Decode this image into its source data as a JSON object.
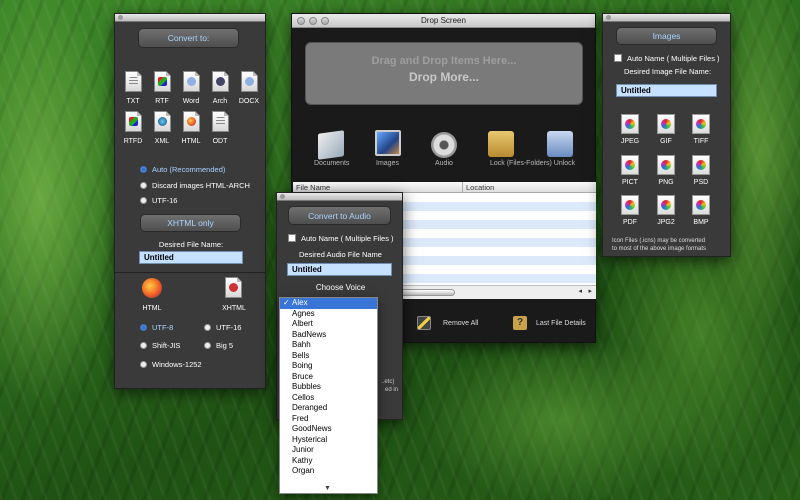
{
  "convert_panel": {
    "title_button": "Convert to:",
    "formats_row1": [
      "TXT",
      "RTF",
      "Word",
      "Arch",
      "DOCX"
    ],
    "formats_row2": [
      "RTFD",
      "XML",
      "HTML",
      "ODT"
    ],
    "options": [
      "Auto (Recommended)",
      "Discard images HTML-ARCH",
      "UTF-16"
    ],
    "xhtml_button": "XHTML only",
    "file_name_label": "Desired File Name:",
    "file_name_value": "Untitled",
    "bottom_formats": [
      "HTML",
      "XHTML"
    ],
    "encodings": [
      "UTF-8",
      "UTF-16",
      "Shift-JIS",
      "Big 5",
      "Windows-1252"
    ]
  },
  "drop_window": {
    "title": "Drop Screen",
    "drop_line1": "Drag and Drop Items Here...",
    "drop_line2": "Drop More...",
    "categories": [
      "Documents",
      "Images",
      "Audio",
      "Lock (Files-Folders) Unlock"
    ],
    "columns": [
      "File Name",
      "Location"
    ],
    "toolbar": {
      "remove_all": "Remove All",
      "last_file_details": "Last File Details"
    }
  },
  "audio_panel": {
    "title_button": "Convert to Audio",
    "auto_name": "Auto Name ( Multiple Files )",
    "file_name_label": "Desired Audio File Name",
    "file_name_value": "Untitled",
    "choose_voice": "Choose Voice",
    "selected_voice": "Alex",
    "partial_text1": "..etc)",
    "partial_text2": "ed in"
  },
  "voices": [
    "Alex",
    "Agnes",
    "Albert",
    "BadNews",
    "Bahh",
    "Bells",
    "Boing",
    "Bruce",
    "Bubbles",
    "Cellos",
    "Deranged",
    "Fred",
    "GoodNews",
    "Hysterical",
    "Junior",
    "Kathy",
    "Organ"
  ],
  "images_panel": {
    "title_button": "Images",
    "auto_name": "Auto Name ( Multiple Files )",
    "file_name_label": "Desired Image File Name:",
    "file_name_value": "Untitled",
    "formats_row1": [
      "JPEG",
      "GIF",
      "TIFF"
    ],
    "formats_row2": [
      "PICT",
      "PNG",
      "PSD"
    ],
    "formats_row3": [
      "PDF",
      "JPG2",
      "BMP"
    ],
    "note_line1": "Icon Files (.icns) may be converted",
    "note_line2": "to most of the above image formats"
  },
  "colors": {
    "accent_blue": "#a8d4ff",
    "field_bg": "#c6e1ff",
    "selection": "#3875d7",
    "panel_bg": "#3a3a3a"
  }
}
